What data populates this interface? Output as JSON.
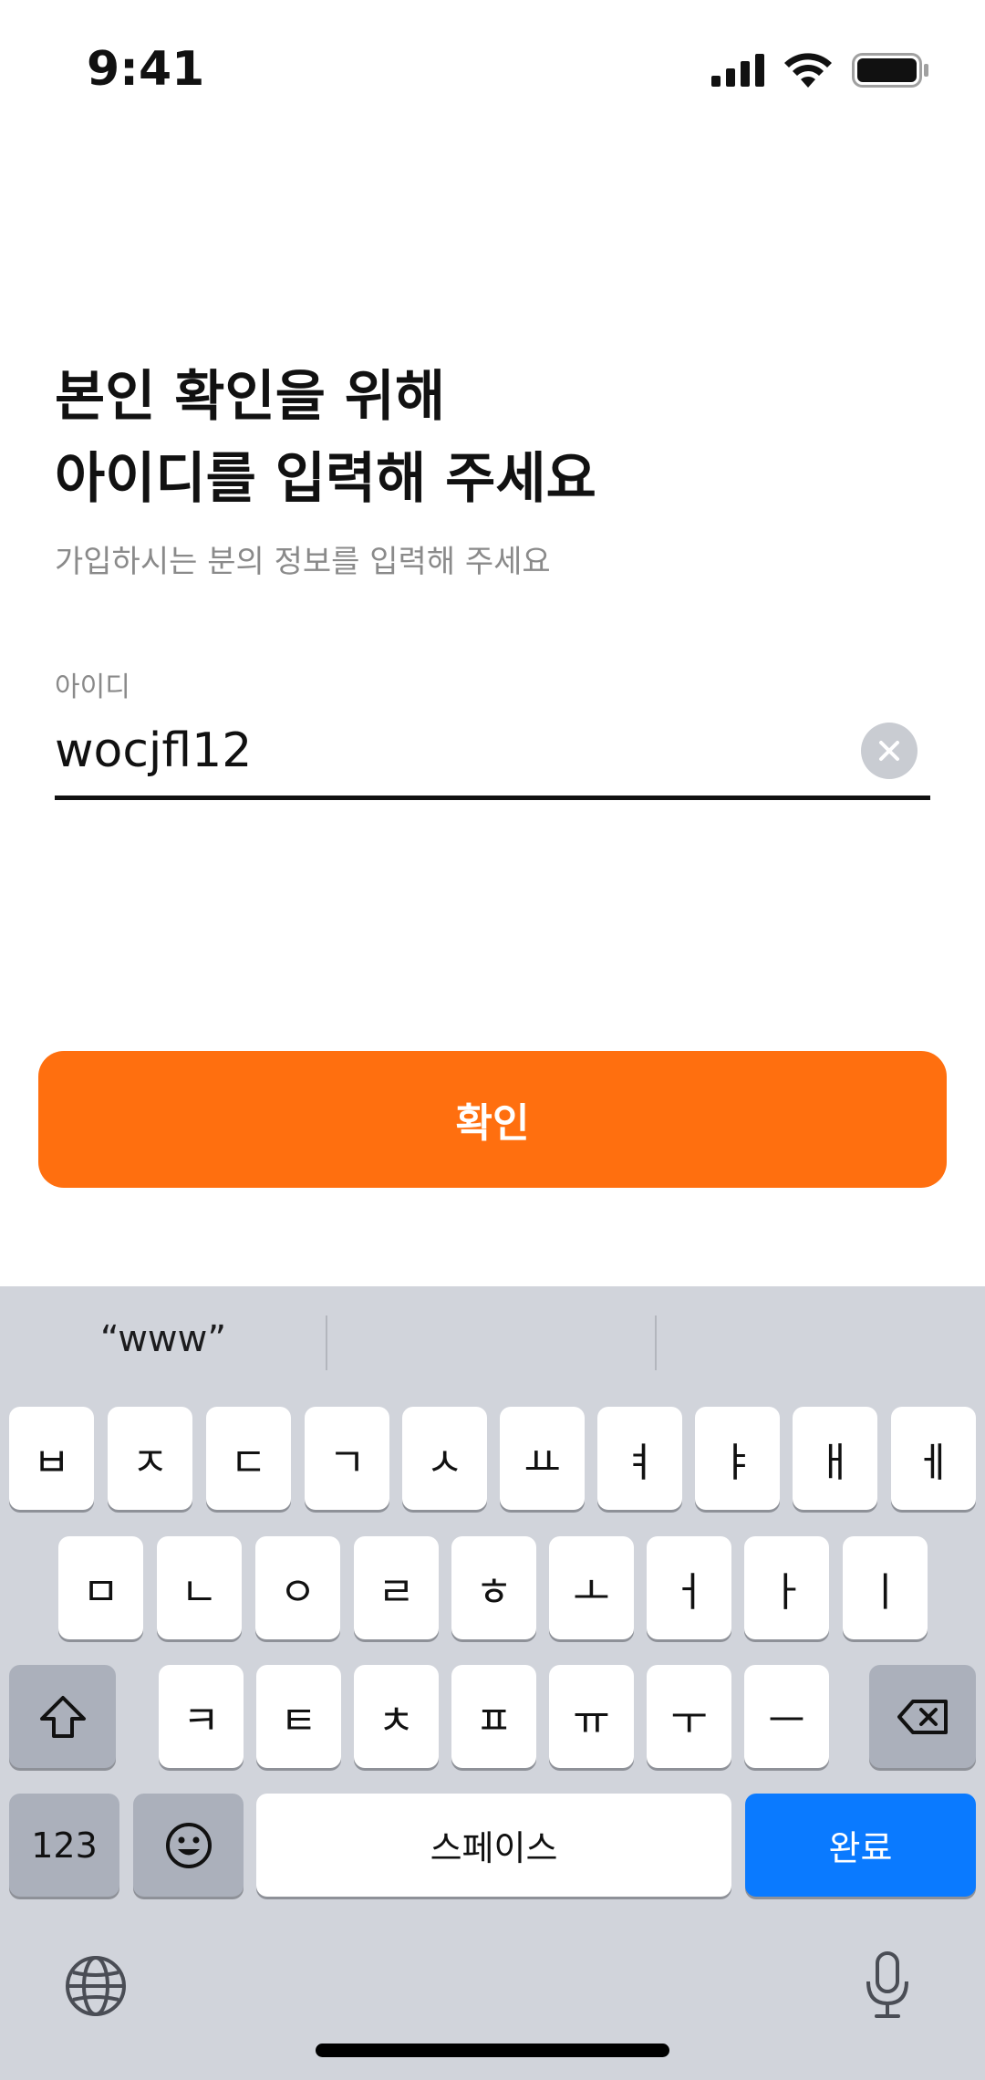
{
  "status_bar": {
    "time": "9:41",
    "icons": [
      "cellular-signal-icon",
      "wifi-icon",
      "battery-icon"
    ]
  },
  "header": {
    "title_line1": "본인 확인을 위해",
    "title_line2": "아이디를 입력해 주세요",
    "subtitle": "가입하시는 분의 정보를 입력해 주세요"
  },
  "form": {
    "id_label": "아이디",
    "id_value": "wocjfl12",
    "clear_icon": "clear-circle-icon"
  },
  "actions": {
    "confirm_label": "확인"
  },
  "keyboard": {
    "suggestions": [
      "“www”",
      "",
      ""
    ],
    "row1": [
      "ㅂ",
      "ㅈ",
      "ㄷ",
      "ㄱ",
      "ㅅ",
      "ㅛ",
      "ㅕ",
      "ㅑ",
      "ㅐ",
      "ㅔ"
    ],
    "row2": [
      "ㅁ",
      "ㄴ",
      "ㅇ",
      "ㄹ",
      "ㅎ",
      "ㅗ",
      "ㅓ",
      "ㅏ",
      "ㅣ"
    ],
    "row3": [
      "ㅋ",
      "ㅌ",
      "ㅊ",
      "ㅍ",
      "ㅠ",
      "ㅜ",
      "ㅡ"
    ],
    "numbers_label": "123",
    "space_label": "스페이스",
    "done_label": "완료",
    "icons": [
      "shift-icon",
      "backspace-icon",
      "emoji-icon",
      "globe-icon",
      "microphone-icon"
    ]
  },
  "colors": {
    "accent": "#ff6f0f",
    "done_key": "#0a7aff",
    "keyboard_bg": "#d1d4db"
  }
}
